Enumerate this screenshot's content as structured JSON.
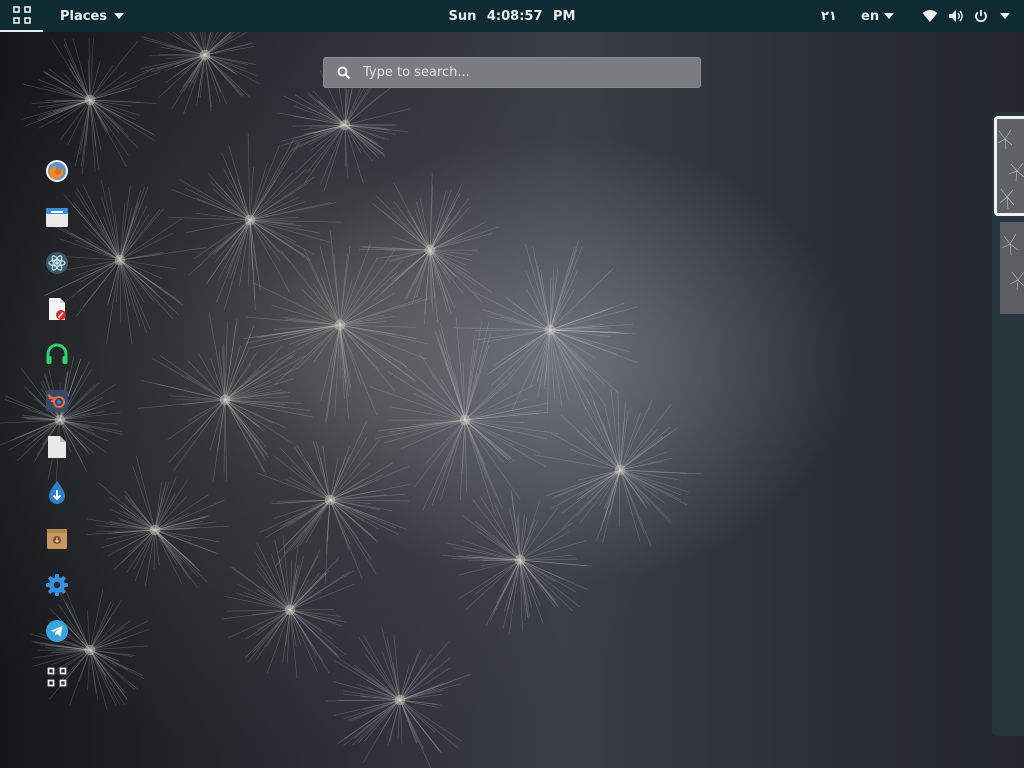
{
  "topbar": {
    "places_label": "Places",
    "clock": "Sun  4:08:57 PM",
    "workspace_number": "٢١",
    "language": "en"
  },
  "search": {
    "placeholder": "Type to search..."
  },
  "dash": {
    "items": [
      {
        "name": "firefox",
        "icon": "firefox-icon"
      },
      {
        "name": "files",
        "icon": "files-icon"
      },
      {
        "name": "atom",
        "icon": "atom-icon"
      },
      {
        "name": "document-viewer",
        "icon": "document-viewer-icon"
      },
      {
        "name": "headphones-app",
        "icon": "headphones-icon"
      },
      {
        "name": "blender",
        "icon": "blender-icon"
      },
      {
        "name": "text-document",
        "icon": "document-icon"
      },
      {
        "name": "downloader",
        "icon": "download-drop-icon"
      },
      {
        "name": "package-installer",
        "icon": "package-icon"
      },
      {
        "name": "settings",
        "icon": "gear-icon"
      },
      {
        "name": "telegram",
        "icon": "telegram-icon"
      },
      {
        "name": "show-applications",
        "icon": "app-grid-icon"
      }
    ]
  },
  "colors": {
    "topbar_bg": "#0e2a33",
    "text": "#eeeeec",
    "search_bg": "#7a7c7f",
    "switcher_bg": "#28363e"
  }
}
